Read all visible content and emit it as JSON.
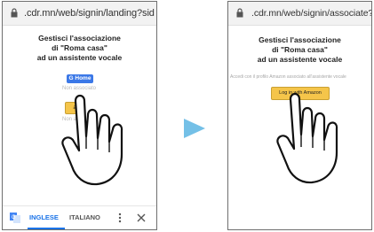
{
  "left_screen": {
    "url": ".cdr.mn/web/signin/landing?sid",
    "title_lines": [
      "Gestisci l'associazione",
      "di \"Roma  casa\"",
      "ad un assistente vocale"
    ],
    "google_home_label": "G Home",
    "google_status": "Non associato",
    "amazon_label": "a",
    "amazon_status": "Non a",
    "translate_bar": {
      "lang_active": "INGLESE",
      "lang_other": "ITALIANO",
      "menu_icon": "more-vert-icon",
      "close_icon": "close-icon"
    }
  },
  "right_screen": {
    "url": ".cdr.mn/web/signin/associate?s",
    "title_lines": [
      "Gestisci l'associazione",
      "di \"Roma  casa\"",
      "ad un assistente vocale"
    ],
    "instruction": "Accedi con il profilo Amazon associato all'assistente vocale",
    "amazon_label": "Log in with Amazon"
  },
  "colors": {
    "arrow": "#74c0e7",
    "google_blue": "#3b78e7",
    "amazon_yellow": "#f5c54a",
    "translate_blue": "#1a73e8"
  }
}
